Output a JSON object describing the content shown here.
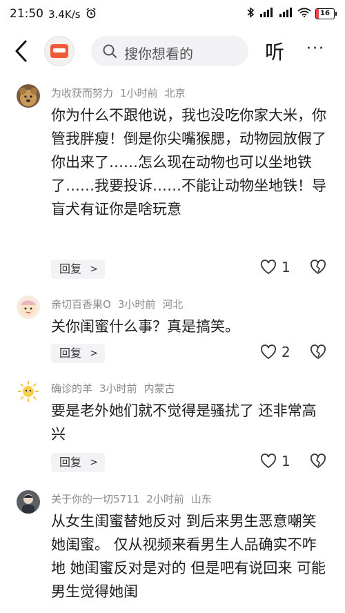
{
  "status_bar": {
    "time": "21:50",
    "network_speed": "3.4K/s",
    "battery": "16"
  },
  "nav": {
    "search_placeholder": "搜你想看的",
    "listen_label": "听",
    "more_label": "···"
  },
  "comments": [
    {
      "username": "为收获而努力",
      "time": "1小时前",
      "location": "北京",
      "text": "你为什么不跟他说，我也没吃你家大米，你管我胖瘦！倒是你尖嘴猴腮，动物园放假了你出来了……怎么现在动物也可以坐地铁了……我要投诉……不能让动物坐地铁！导盲犬有证你是啥玩意",
      "reply_label": "回复",
      "likes": "1"
    },
    {
      "username": "亲切百香果O",
      "time": "3小时前",
      "location": "河北",
      "text": "关你闺蜜什么事？真是搞笑。",
      "reply_label": "回复",
      "likes": "2"
    },
    {
      "username": "确诊的羊",
      "time": "3小时前",
      "location": "内蒙古",
      "text": "要是老外她们就不觉得是骚扰了 还非常高兴",
      "reply_label": "回复",
      "likes": "1"
    },
    {
      "username": "关于你的一切5711",
      "time": "2小时前",
      "location": "山东",
      "text": "从女生闺蜜替她反对 到后来男生恶意嘲笑她闺蜜。 仅从视频来看男生人品确实不咋地 她闺蜜反对是对的 但是吧有说回来 可能男生觉得她闺"
    }
  ],
  "colors": {
    "app_icon": "#f05a3a",
    "battery_low": "#e5484d",
    "meta_gray": "#8a8a8a"
  }
}
